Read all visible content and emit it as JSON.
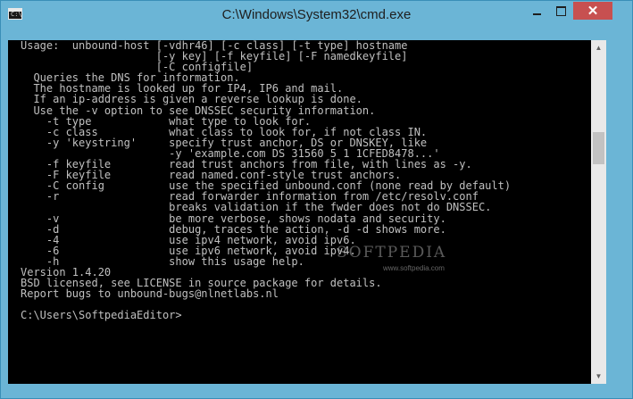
{
  "window": {
    "title": "C:\\Windows\\System32\\cmd.exe",
    "icon_label": "C:\\",
    "minimize_icon": "minimize-icon",
    "maximize_icon": "maximize-icon",
    "close_icon": "close-icon",
    "close_glyph": "✕"
  },
  "console": {
    "lines": [
      "Usage:  unbound-host [-vdhr46] [-c class] [-t type] hostname",
      "                     [-y key] [-f keyfile] [-F namedkeyfile]",
      "                     [-C configfile]",
      "  Queries the DNS for information.",
      "  The hostname is looked up for IP4, IP6 and mail.",
      "  If an ip-address is given a reverse lookup is done.",
      "  Use the -v option to see DNSSEC security information.",
      "    -t type            what type to look for.",
      "    -c class           what class to look for, if not class IN.",
      "    -y 'keystring'     specify trust anchor, DS or DNSKEY, like",
      "                       -y 'example.com DS 31560 5 1 1CFED8478...'",
      "    -f keyfile         read trust anchors from file, with lines as -y.",
      "    -F keyfile         read named.conf-style trust anchors.",
      "    -C config          use the specified unbound.conf (none read by default)",
      "    -r                 read forwarder information from /etc/resolv.conf",
      "                       breaks validation if the fwder does not do DNSSEC.",
      "    -v                 be more verbose, shows nodata and security.",
      "    -d                 debug, traces the action, -d -d shows more.",
      "    -4                 use ipv4 network, avoid ipv6.",
      "    -6                 use ipv6 network, avoid ipv4.",
      "    -h                 show this usage help.",
      "Version 1.4.20",
      "BSD licensed, see LICENSE in source package for details.",
      "Report bugs to unbound-bugs@nlnetlabs.nl",
      "",
      "C:\\Users\\SoftpediaEditor>"
    ],
    "text_color": "#c0c0c0",
    "background": "#000000"
  },
  "watermark": {
    "brand": "SOFTPEDIA",
    "url": "www.softpedia.com"
  },
  "colors": {
    "titlebar": "#6bb5d6",
    "close_button": "#c75050"
  }
}
